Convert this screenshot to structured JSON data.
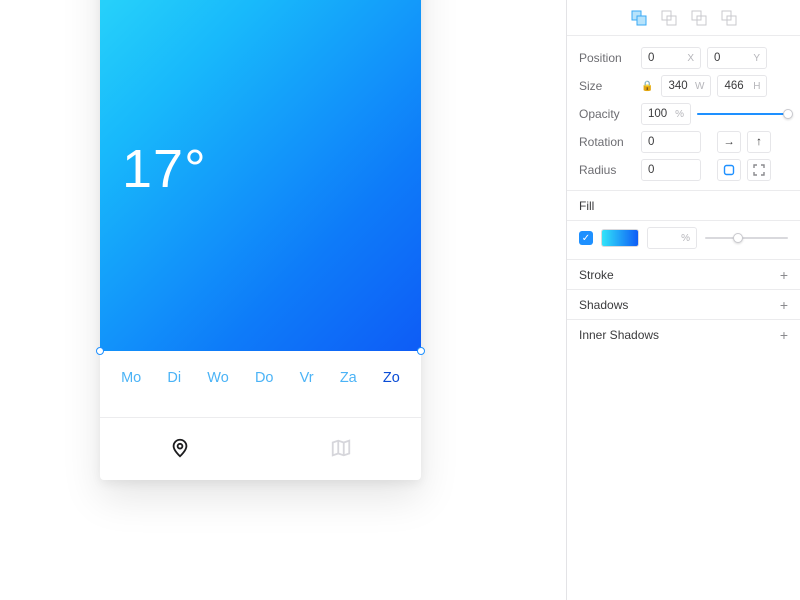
{
  "canvas": {
    "temperature": "17°",
    "days": [
      "Mo",
      "Di",
      "Wo",
      "Do",
      "Vr",
      "Za",
      "Zo"
    ],
    "active_day_index": 6
  },
  "inspector": {
    "position": {
      "label": "Position",
      "x": "0",
      "y": "0",
      "x_suffix": "X",
      "y_suffix": "Y"
    },
    "size": {
      "label": "Size",
      "w": "340",
      "h": "466",
      "w_suffix": "W",
      "h_suffix": "H"
    },
    "opacity": {
      "label": "Opacity",
      "value": "100",
      "suffix": "%",
      "slider_pct": 100
    },
    "rotation": {
      "label": "Rotation",
      "value": "0"
    },
    "radius": {
      "label": "Radius",
      "value": "0"
    },
    "fill": {
      "label": "Fill",
      "percent_suffix": "%",
      "slider_pct": 40
    },
    "sections": {
      "stroke": "Stroke",
      "shadows": "Shadows",
      "inner_shadows": "Inner Shadows"
    }
  }
}
